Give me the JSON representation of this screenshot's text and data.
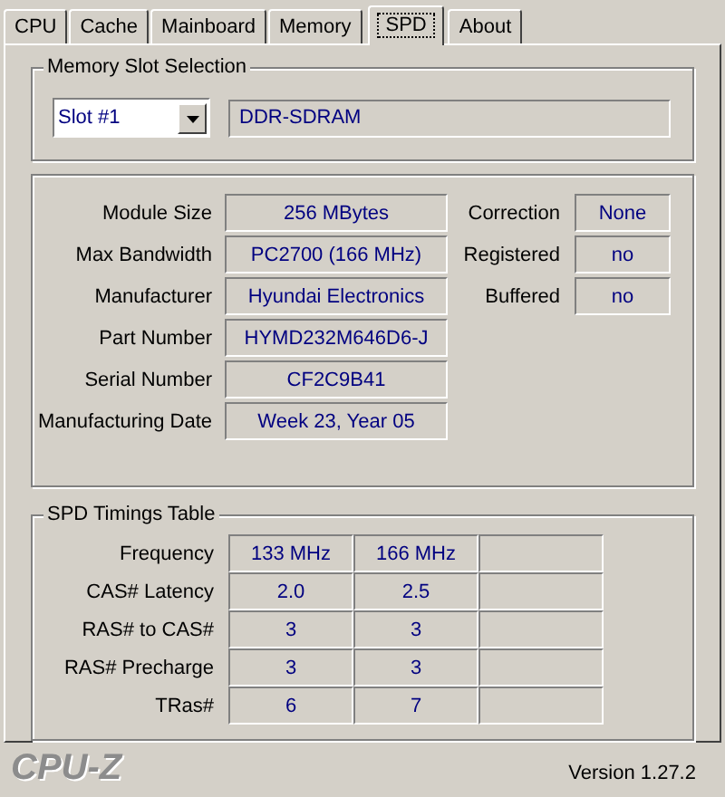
{
  "tabs": [
    {
      "label": "CPU",
      "selected": false
    },
    {
      "label": "Cache",
      "selected": false
    },
    {
      "label": "Mainboard",
      "selected": false
    },
    {
      "label": "Memory",
      "selected": false
    },
    {
      "label": "SPD",
      "selected": true
    },
    {
      "label": "About",
      "selected": false
    }
  ],
  "memory_slot_selection": {
    "title": "Memory Slot Selection",
    "slot_dropdown": {
      "value": "Slot #1"
    },
    "memory_type": "DDR-SDRAM"
  },
  "module_info": {
    "fields": [
      {
        "label": "Module Size",
        "value": "256 MBytes"
      },
      {
        "label": "Max Bandwidth",
        "value": "PC2700 (166 MHz)"
      },
      {
        "label": "Manufacturer",
        "value": "Hyundai Electronics"
      },
      {
        "label": "Part Number",
        "value": "HYMD232M646D6-J"
      },
      {
        "label": "Serial Number",
        "value": "CF2C9B41"
      },
      {
        "label": "Manufacturing Date",
        "value": "Week 23, Year 05"
      }
    ],
    "flags": [
      {
        "label": "Correction",
        "value": "None"
      },
      {
        "label": "Registered",
        "value": "no"
      },
      {
        "label": "Buffered",
        "value": "no"
      }
    ]
  },
  "spd_timings_table": {
    "title": "SPD Timings Table",
    "rows": [
      {
        "label": "Frequency",
        "values": [
          "133 MHz",
          "166 MHz"
        ]
      },
      {
        "label": "CAS# Latency",
        "values": [
          "2.0",
          "2.5"
        ]
      },
      {
        "label": "RAS# to CAS#",
        "values": [
          "3",
          "3"
        ]
      },
      {
        "label": "RAS# Precharge",
        "values": [
          "3",
          "3"
        ]
      },
      {
        "label": "TRas#",
        "values": [
          "6",
          "7"
        ]
      }
    ]
  },
  "footer": {
    "logo": "CPU-Z",
    "version": "Version 1.27.2"
  }
}
